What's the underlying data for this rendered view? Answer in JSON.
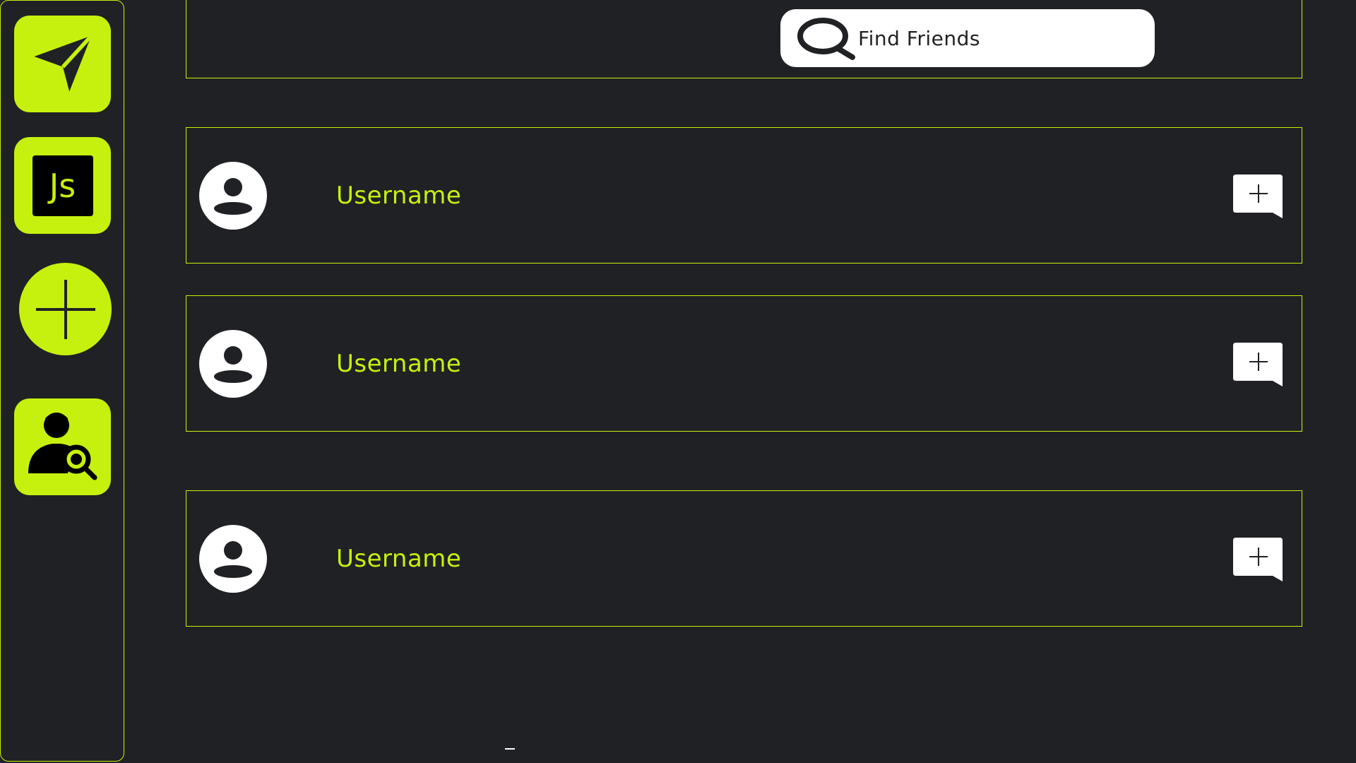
{
  "colors": {
    "accent": "#c6f10e",
    "background": "#202124",
    "white": "#ffffff"
  },
  "sidebar": {
    "items": [
      {
        "icon": "send-icon"
      },
      {
        "icon": "js-icon",
        "label": "Js"
      },
      {
        "icon": "plus-icon"
      },
      {
        "icon": "find-user-icon"
      }
    ]
  },
  "search": {
    "placeholder": "Find Friends"
  },
  "friends": [
    {
      "username": "Username"
    },
    {
      "username": "Username"
    },
    {
      "username": "Username"
    }
  ],
  "footer": {
    "dash": "–"
  }
}
